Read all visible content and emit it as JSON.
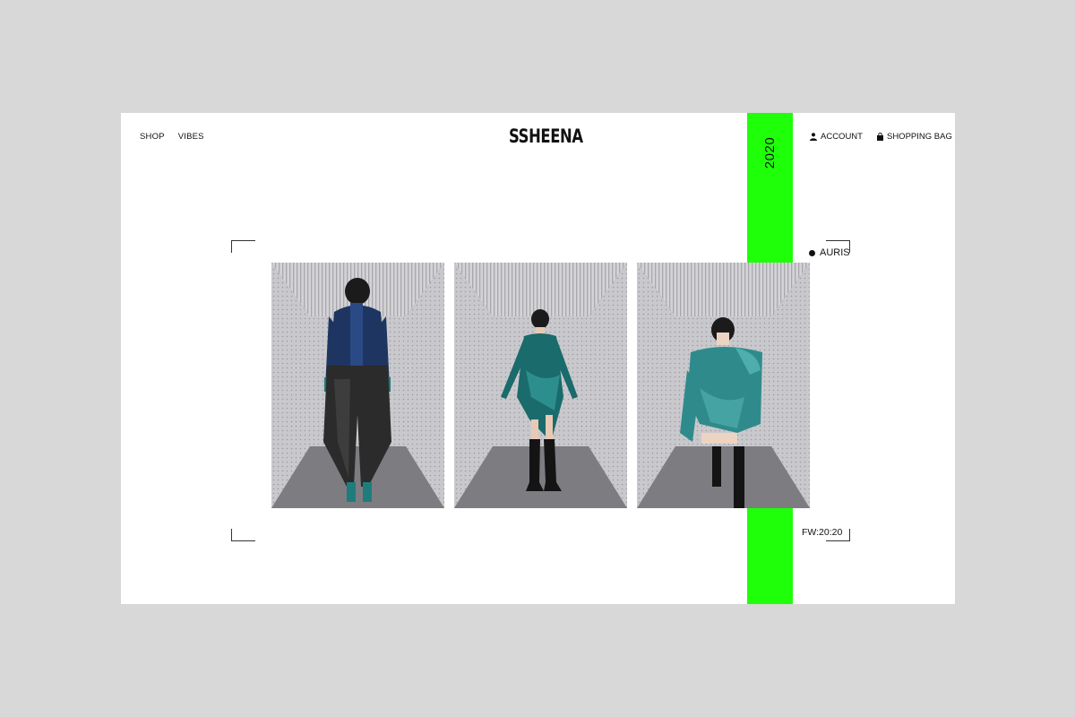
{
  "nav": {
    "left": [
      {
        "label": "SHOP"
      },
      {
        "label": "VIBES"
      }
    ],
    "logo": "SSHEENA",
    "account": {
      "label": "ACCOUNT",
      "icon": "user-icon"
    },
    "bag": {
      "label": "SHOPPING BAG",
      "icon": "bag-icon"
    }
  },
  "side_banner": {
    "year": "2020",
    "color": "#1fff0a"
  },
  "collection": {
    "name": "AURIS",
    "season": "FW:20:20"
  },
  "gallery": {
    "photos": [
      {
        "subject": "model-back-view-navy-top-black-leather-pants",
        "outfit_color": "#1d3560"
      },
      {
        "subject": "model-standing-teal-velvet-dress-black-boots",
        "outfit_color": "#1a6b6b"
      },
      {
        "subject": "model-crouching-teal-velvet-dress",
        "outfit_color": "#2f8b8b"
      }
    ]
  },
  "colors": {
    "page_bg": "#d8d8d8",
    "site_bg": "#ffffff",
    "accent": "#1fff0a",
    "text": "#111111"
  }
}
